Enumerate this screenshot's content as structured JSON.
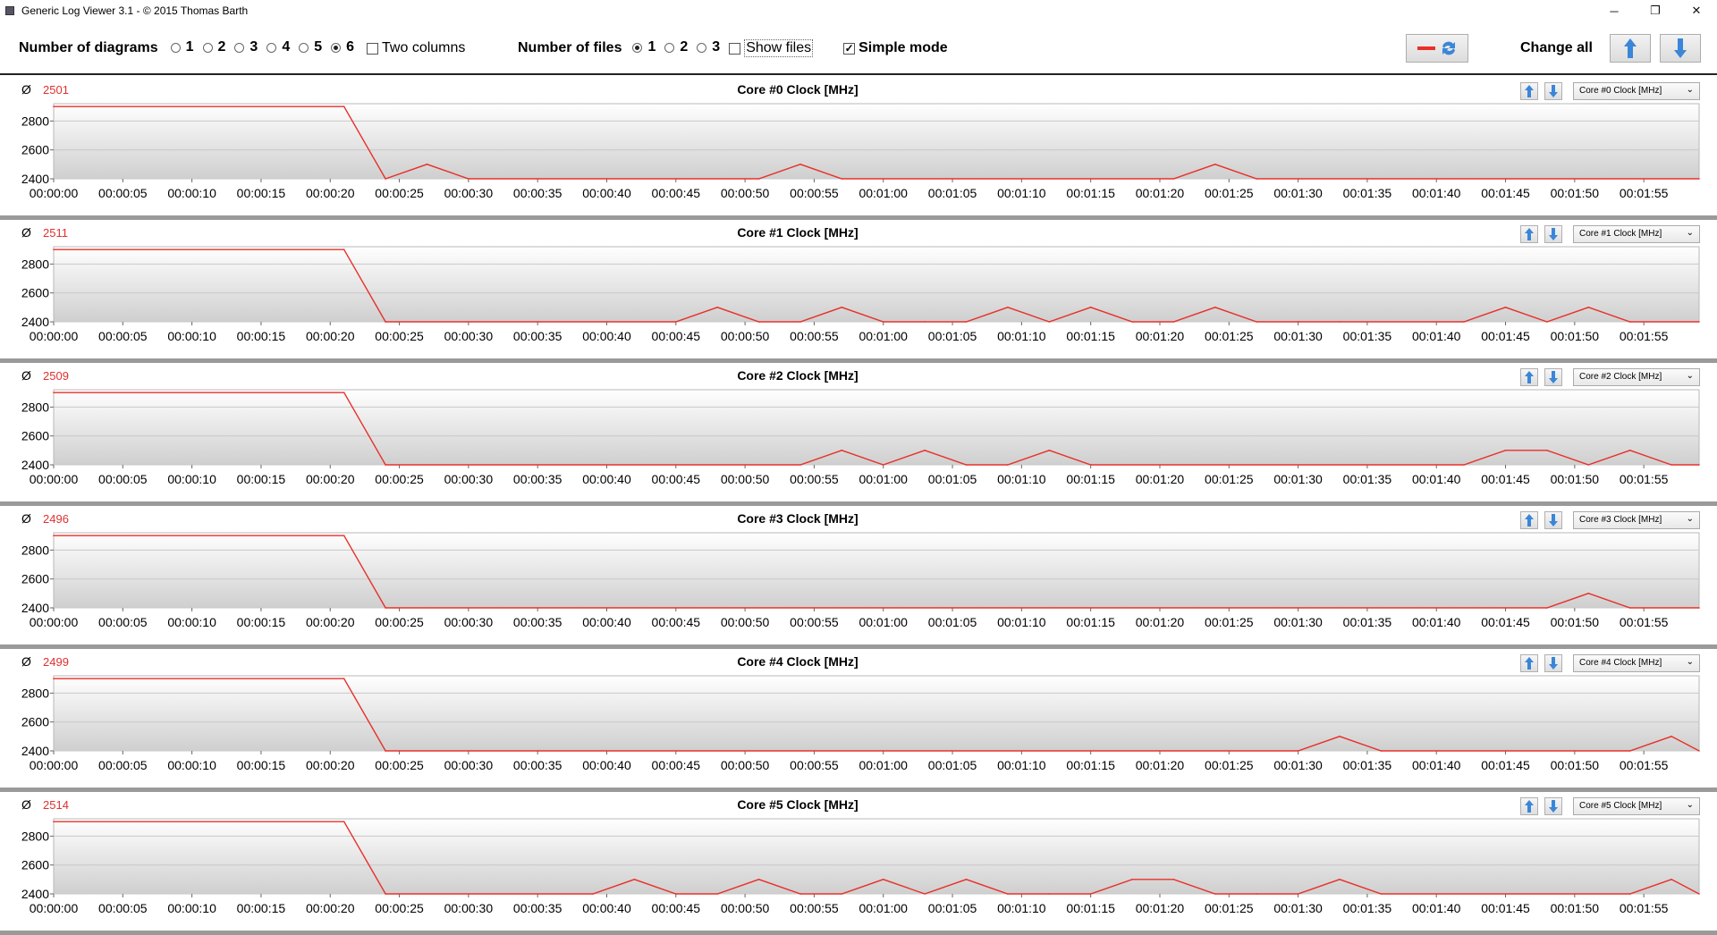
{
  "window": {
    "title": "Generic Log Viewer 3.1 - © 2015 Thomas Barth",
    "minimize": "─",
    "maximize": "❐",
    "close": "✕"
  },
  "toolbar": {
    "diagrams_label": "Number of diagrams",
    "diagram_options": [
      "1",
      "2",
      "3",
      "4",
      "5",
      "6"
    ],
    "diagram_selected": "6",
    "two_columns_label": "Two columns",
    "two_columns_checked": false,
    "files_label": "Number of files",
    "file_options": [
      "1",
      "2",
      "3"
    ],
    "file_selected": "1",
    "show_files_label": "Show files",
    "show_files_checked": false,
    "simple_mode_label": "Simple mode",
    "simple_mode_checked": true,
    "change_all_label": "Change all"
  },
  "colors": {
    "line": "#e8302a",
    "avg": "#e03030",
    "arrow_blue": "#3a86d8",
    "grid": "#c8c8c8"
  },
  "chart_data": [
    {
      "type": "line",
      "title": "Core #0 Clock [MHz]",
      "avg_symbol": "Ø",
      "average": "2501",
      "dropdown": "Core #0 Clock [MHz]",
      "yticks": [
        2400,
        2600,
        2800
      ],
      "ylim": [
        2400,
        2920
      ],
      "xticks": [
        "00:00:00",
        "00:00:05",
        "00:00:10",
        "00:00:15",
        "00:00:20",
        "00:00:25",
        "00:00:30",
        "00:00:35",
        "00:00:40",
        "00:00:45",
        "00:00:50",
        "00:00:55",
        "00:01:00",
        "00:01:05",
        "00:01:10",
        "00:01:15",
        "00:01:20",
        "00:01:25",
        "00:01:30",
        "00:01:35",
        "00:01:40",
        "00:01:45",
        "00:01:50",
        "00:01:55"
      ],
      "x": [
        0,
        21,
        24,
        27,
        30,
        51,
        54,
        57,
        81,
        84,
        87,
        119
      ],
      "y": [
        2900,
        2900,
        2400,
        2500,
        2400,
        2400,
        2500,
        2400,
        2400,
        2500,
        2400,
        2400
      ]
    },
    {
      "type": "line",
      "title": "Core #1 Clock [MHz]",
      "avg_symbol": "Ø",
      "average": "2511",
      "dropdown": "Core #1 Clock [MHz]",
      "yticks": [
        2400,
        2600,
        2800
      ],
      "ylim": [
        2400,
        2920
      ],
      "xticks": [
        "00:00:00",
        "00:00:05",
        "00:00:10",
        "00:00:15",
        "00:00:20",
        "00:00:25",
        "00:00:30",
        "00:00:35",
        "00:00:40",
        "00:00:45",
        "00:00:50",
        "00:00:55",
        "00:01:00",
        "00:01:05",
        "00:01:10",
        "00:01:15",
        "00:01:20",
        "00:01:25",
        "00:01:30",
        "00:01:35",
        "00:01:40",
        "00:01:45",
        "00:01:50",
        "00:01:55"
      ],
      "x": [
        0,
        21,
        24,
        45,
        48,
        51,
        54,
        57,
        60,
        63,
        66,
        69,
        72,
        75,
        78,
        81,
        84,
        87,
        90,
        93,
        102,
        105,
        108,
        111,
        114,
        119
      ],
      "y": [
        2900,
        2900,
        2400,
        2400,
        2500,
        2400,
        2400,
        2500,
        2400,
        2400,
        2400,
        2500,
        2400,
        2500,
        2400,
        2400,
        2500,
        2400,
        2400,
        2400,
        2400,
        2500,
        2400,
        2500,
        2400,
        2400
      ]
    },
    {
      "type": "line",
      "title": "Core #2 Clock [MHz]",
      "avg_symbol": "Ø",
      "average": "2509",
      "dropdown": "Core #2 Clock [MHz]",
      "yticks": [
        2400,
        2600,
        2800
      ],
      "ylim": [
        2400,
        2920
      ],
      "xticks": [
        "00:00:00",
        "00:00:05",
        "00:00:10",
        "00:00:15",
        "00:00:20",
        "00:00:25",
        "00:00:30",
        "00:00:35",
        "00:00:40",
        "00:00:45",
        "00:00:50",
        "00:00:55",
        "00:01:00",
        "00:01:05",
        "00:01:10",
        "00:01:15",
        "00:01:20",
        "00:01:25",
        "00:01:30",
        "00:01:35",
        "00:01:40",
        "00:01:45",
        "00:01:50",
        "00:01:55"
      ],
      "x": [
        0,
        21,
        24,
        54,
        57,
        60,
        63,
        66,
        69,
        72,
        75,
        102,
        105,
        108,
        111,
        114,
        117,
        119
      ],
      "y": [
        2900,
        2900,
        2400,
        2400,
        2500,
        2400,
        2500,
        2400,
        2400,
        2500,
        2400,
        2400,
        2500,
        2500,
        2400,
        2500,
        2400,
        2400
      ]
    },
    {
      "type": "line",
      "title": "Core #3 Clock [MHz]",
      "avg_symbol": "Ø",
      "average": "2496",
      "dropdown": "Core #3 Clock [MHz]",
      "yticks": [
        2400,
        2600,
        2800
      ],
      "ylim": [
        2400,
        2920
      ],
      "xticks": [
        "00:00:00",
        "00:00:05",
        "00:00:10",
        "00:00:15",
        "00:00:20",
        "00:00:25",
        "00:00:30",
        "00:00:35",
        "00:00:40",
        "00:00:45",
        "00:00:50",
        "00:00:55",
        "00:01:00",
        "00:01:05",
        "00:01:10",
        "00:01:15",
        "00:01:20",
        "00:01:25",
        "00:01:30",
        "00:01:35",
        "00:01:40",
        "00:01:45",
        "00:01:50",
        "00:01:55"
      ],
      "x": [
        0,
        21,
        24,
        108,
        111,
        114,
        119
      ],
      "y": [
        2900,
        2900,
        2400,
        2400,
        2500,
        2400,
        2400
      ]
    },
    {
      "type": "line",
      "title": "Core #4 Clock [MHz]",
      "avg_symbol": "Ø",
      "average": "2499",
      "dropdown": "Core #4 Clock [MHz]",
      "yticks": [
        2400,
        2600,
        2800
      ],
      "ylim": [
        2400,
        2920
      ],
      "xticks": [
        "00:00:00",
        "00:00:05",
        "00:00:10",
        "00:00:15",
        "00:00:20",
        "00:00:25",
        "00:00:30",
        "00:00:35",
        "00:00:40",
        "00:00:45",
        "00:00:50",
        "00:00:55",
        "00:01:00",
        "00:01:05",
        "00:01:10",
        "00:01:15",
        "00:01:20",
        "00:01:25",
        "00:01:30",
        "00:01:35",
        "00:01:40",
        "00:01:45",
        "00:01:50",
        "00:01:55"
      ],
      "x": [
        0,
        21,
        24,
        90,
        93,
        96,
        114,
        117,
        119
      ],
      "y": [
        2900,
        2900,
        2400,
        2400,
        2500,
        2400,
        2400,
        2500,
        2400
      ]
    },
    {
      "type": "line",
      "title": "Core #5 Clock [MHz]",
      "avg_symbol": "Ø",
      "average": "2514",
      "dropdown": "Core #5 Clock [MHz]",
      "yticks": [
        2400,
        2600,
        2800
      ],
      "ylim": [
        2400,
        2920
      ],
      "xticks": [
        "00:00:00",
        "00:00:05",
        "00:00:10",
        "00:00:15",
        "00:00:20",
        "00:00:25",
        "00:00:30",
        "00:00:35",
        "00:00:40",
        "00:00:45",
        "00:00:50",
        "00:00:55",
        "00:01:00",
        "00:01:05",
        "00:01:10",
        "00:01:15",
        "00:01:20",
        "00:01:25",
        "00:01:30",
        "00:01:35",
        "00:01:40",
        "00:01:45",
        "00:01:50",
        "00:01:55"
      ],
      "x": [
        0,
        21,
        24,
        39,
        42,
        45,
        48,
        51,
        54,
        57,
        60,
        63,
        66,
        69,
        72,
        75,
        78,
        81,
        84,
        87,
        90,
        93,
        96,
        114,
        117,
        119
      ],
      "y": [
        2900,
        2900,
        2400,
        2400,
        2500,
        2400,
        2400,
        2500,
        2400,
        2400,
        2500,
        2400,
        2500,
        2400,
        2400,
        2400,
        2500,
        2500,
        2400,
        2400,
        2400,
        2500,
        2400,
        2400,
        2500,
        2400
      ]
    }
  ]
}
